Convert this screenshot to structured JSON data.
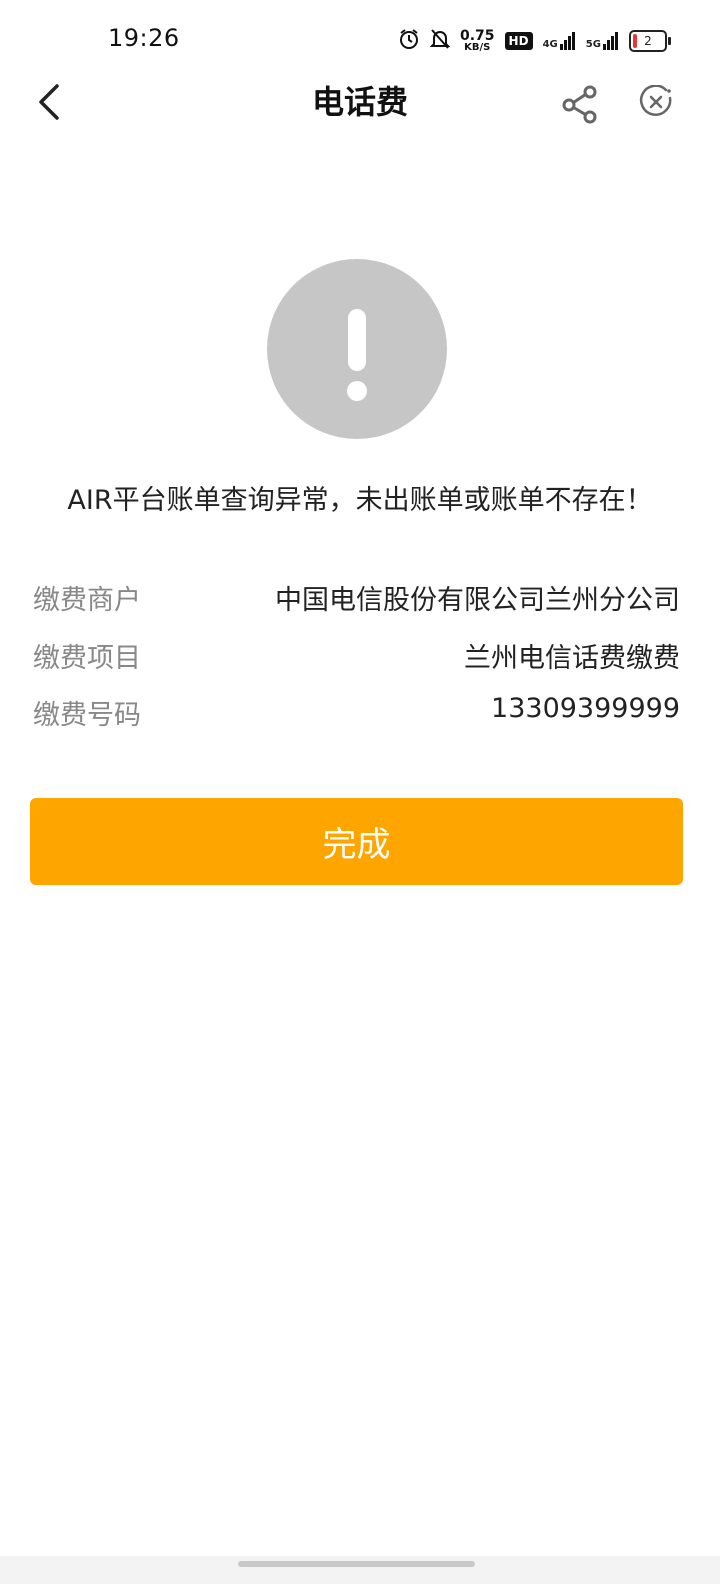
{
  "status_bar": {
    "time": "19:26",
    "net_speed_value": "0.75",
    "net_speed_unit": "KB/S",
    "hd_label": "HD",
    "signal_1": "4G",
    "signal_2": "5G",
    "battery_level": "2"
  },
  "nav": {
    "title": "电话费"
  },
  "result": {
    "message": "AIR平台账单查询异常，未出账单或账单不存在！",
    "icon": "alert-exclamation-icon",
    "icon_color": "#c6c6c6"
  },
  "details": [
    {
      "label": "缴费商户",
      "value": "中国电信股份有限公司兰州分公司"
    },
    {
      "label": "缴费项目",
      "value": "兰州电信话费缴费"
    },
    {
      "label": "缴费号码",
      "value": "13309399999"
    }
  ],
  "actions": {
    "done_label": "完成",
    "accent_color": "#ffa500"
  }
}
